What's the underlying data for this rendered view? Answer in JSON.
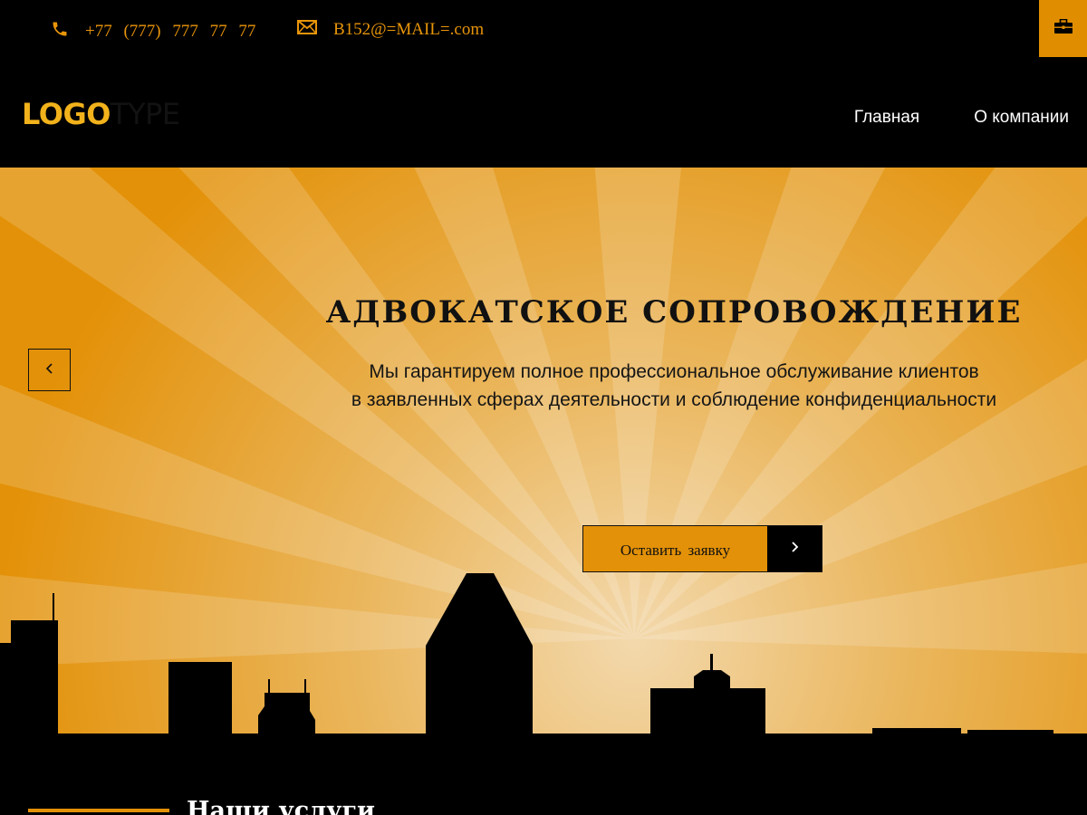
{
  "topbar": {
    "phone": "+77 (777) 777 77 77",
    "email": "B152@=MAIL=.com",
    "phone_icon": "phone-icon",
    "email_icon": "envelope-icon",
    "case_icon": "briefcase-icon"
  },
  "header": {
    "logo_bold": "LOGO",
    "logo_light": "TYPE",
    "nav": [
      "Главная",
      "О компании"
    ]
  },
  "hero": {
    "title": "АДВОКАТСКОЕ СОПРОВОЖДЕНИЕ",
    "subtitle_line1": "Мы гарантируем полное профессиональное обслуживание клиентов",
    "subtitle_line2": "в заявленных сферах деятельности и соблюдение конфиденциальности",
    "cta_label": "Оставить заявку",
    "prev_icon": "chevron-left-icon",
    "cta_icon": "chevron-right-icon"
  },
  "services": {
    "title": "Наши услуги"
  },
  "colors": {
    "accent": "#e39108",
    "background": "#000000",
    "logo_yellow": "#f2b21b"
  }
}
